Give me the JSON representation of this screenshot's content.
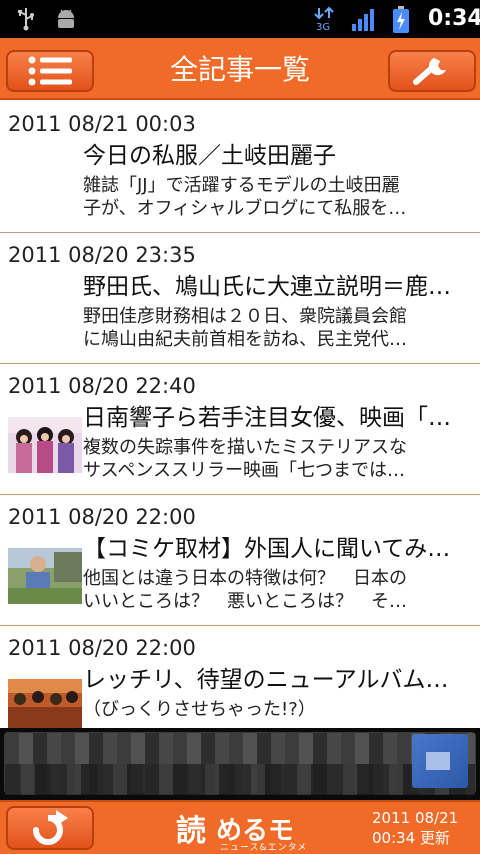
{
  "statusbar": {
    "time": "0:34",
    "network": "3G"
  },
  "header": {
    "title": "全記事一覧"
  },
  "articles": [
    {
      "date": "2011 08/21 00:03",
      "headline": "今日の私服／土岐田麗子",
      "summary1": "雑誌「JJ」で活躍するモデルの土岐田麗",
      "summary2": "子が、オフィシャルブログにて私服を…",
      "has_thumb": false
    },
    {
      "date": "2011 08/20 23:35",
      "headline": "野田氏、鳩山氏に大連立説明＝鹿…",
      "summary1": "野田佳彦財務相は２０日、衆院議員会館",
      "summary2": "に鳩山由紀夫前首相を訪ね、民主党代…",
      "has_thumb": false
    },
    {
      "date": "2011 08/20 22:40",
      "headline": "日南響子ら若手注目女優、映画「…",
      "summary1": "複数の失踪事件を描いたミステリアスな",
      "summary2": "サスペンススリラー映画「七つまでは…",
      "has_thumb": true
    },
    {
      "date": "2011 08/20 22:00",
      "headline": "【コミケ取材】外国人に聞いてみ…",
      "summary1": "他国とは違う日本の特徴は何？　日本の",
      "summary2": "いいところは？　悪いところは？　そ…",
      "has_thumb": true
    },
    {
      "date": "2011 08/20 22:00",
      "headline": "レッチリ、待望のニューアルバム…",
      "summary1": "（びっくりさせちゃった!?）",
      "summary2": "",
      "has_thumb": true
    }
  ],
  "footer": {
    "brand_kanji": "読",
    "brand_kana": "めるモ",
    "brand_sub": "ニュース&エンタメ",
    "updated_date": "2011 08/21",
    "updated_time": "00:34 更新"
  },
  "colors": {
    "accent": "#f06a28",
    "divider": "#c8a070"
  }
}
